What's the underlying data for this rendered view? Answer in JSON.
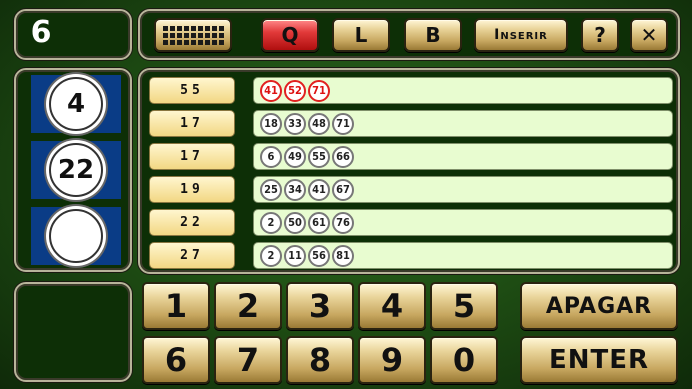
{
  "header": {
    "ball_count": "6"
  },
  "toolbar": {
    "grid_icon": "grid-icon",
    "q_label": "Q",
    "l_label": "L",
    "b_label": "B",
    "inserir_label": "Inserir",
    "help_label": "?",
    "close_label": "✕"
  },
  "drawn_balls": [
    "4",
    "22",
    ""
  ],
  "cards": [
    {
      "count": "55",
      "numbers": [
        "41",
        "52",
        "71"
      ],
      "hits": [
        true,
        true,
        true
      ]
    },
    {
      "count": "17",
      "numbers": [
        "18",
        "33",
        "48",
        "71"
      ],
      "hits": [
        false,
        false,
        false,
        false
      ]
    },
    {
      "count": "17",
      "numbers": [
        "6",
        "49",
        "55",
        "66"
      ],
      "hits": [
        false,
        false,
        false,
        false
      ]
    },
    {
      "count": "19",
      "numbers": [
        "25",
        "34",
        "41",
        "67"
      ],
      "hits": [
        false,
        false,
        false,
        false
      ]
    },
    {
      "count": "22",
      "numbers": [
        "2",
        "50",
        "61",
        "76"
      ],
      "hits": [
        false,
        false,
        false,
        false
      ]
    },
    {
      "count": "27",
      "numbers": [
        "2",
        "11",
        "56",
        "81"
      ],
      "hits": [
        false,
        false,
        false,
        false
      ]
    }
  ],
  "keypad": [
    "1",
    "2",
    "3",
    "4",
    "5",
    "6",
    "7",
    "8",
    "9",
    "0"
  ],
  "actions": {
    "apagar": "APAGAR",
    "enter": "ENTER"
  },
  "colors": {
    "hit": "#d11111",
    "drawn_slot": "#0a3c86",
    "card_bg": "#e8fcd0"
  }
}
